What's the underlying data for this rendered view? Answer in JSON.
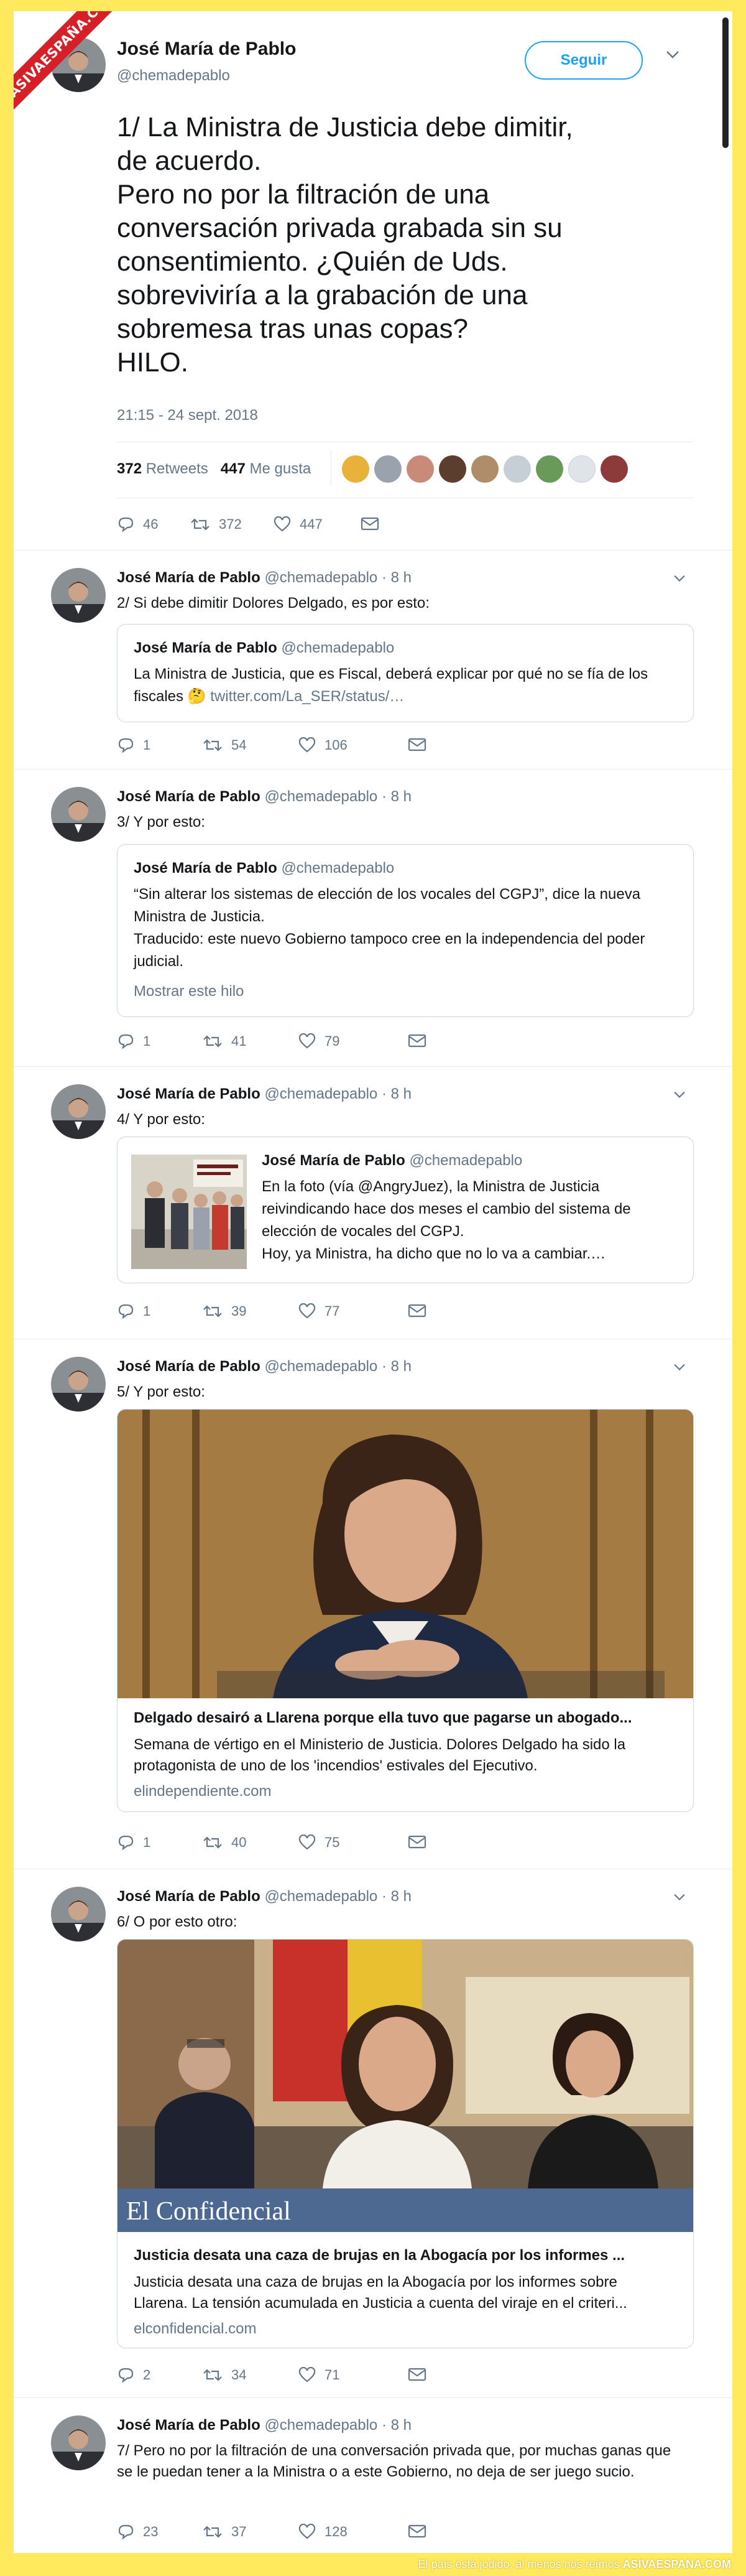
{
  "watermark": "ASIVAESPAÑA.COM",
  "main_tweet": {
    "name": "José María de Pablo",
    "handle": "@chemadepablo",
    "follow_label": "Seguir",
    "text": "1/ La Ministra de Justicia debe dimitir,\nde acuerdo.\nPero no por la filtración de una\nconversación privada grabada sin su\nconsentimiento. ¿Quién de Uds.\nsobreviviría a la grabación de una\nsobremesa tras unas copas?\nHILO.",
    "time": "21:15 - 24 sept. 2018",
    "retweets_count": "372",
    "retweets_label": "Retweets",
    "likes_count": "447",
    "likes_label": "Me gusta",
    "actions": {
      "reply": "46",
      "retweet": "372",
      "like": "447"
    }
  },
  "replies": [
    {
      "name": "José María de Pablo",
      "handle": "@chemadepablo",
      "time": "· 8 h",
      "text": "2/ Si debe dimitir Dolores Delgado, es por esto:",
      "quote": {
        "name": "José María de Pablo",
        "handle": "@chemadepablo",
        "text": "La Ministra de Justicia, que es Fiscal, deberá explicar por qué no se fía de los fiscales 🤔",
        "link": " twitter.com/La_SER/status/…"
      },
      "actions": {
        "reply": "1",
        "retweet": "54",
        "like": "106"
      }
    },
    {
      "name": "José María de Pablo",
      "handle": "@chemadepablo",
      "time": "· 8 h",
      "text": "3/ Y por esto:",
      "quote": {
        "name": "José María de Pablo",
        "handle": "@chemadepablo",
        "text": "“Sin alterar los sistemas de elección de los vocales del CGPJ”, dice la nueva Ministra de Justicia.\nTraducido: este nuevo Gobierno tampoco cree en la independencia del poder judicial.",
        "show_thread": "Mostrar este hilo"
      },
      "actions": {
        "reply": "1",
        "retweet": "41",
        "like": "79"
      }
    },
    {
      "name": "José María de Pablo",
      "handle": "@chemadepablo",
      "time": "· 8 h",
      "text": "4/ Y por esto:",
      "quote": {
        "name": "José María de Pablo",
        "handle": "@chemadepablo",
        "text": "En la foto (vía @AngryJuez), la Ministra de Justicia reivindicando hace dos meses el cambio del sistema de elección de vocales del CGPJ.\nHoy, ya Ministra, ha dicho que no lo va a cambiar.…"
      },
      "actions": {
        "reply": "1",
        "retweet": "39",
        "like": "77"
      }
    },
    {
      "name": "José María de Pablo",
      "handle": "@chemadepablo",
      "time": "· 8 h",
      "text": "5/ Y por esto:",
      "card": {
        "title": "Delgado desairó a Llarena porque ella tuvo que pagarse un abogado...",
        "description": "Semana de vértigo en el Ministerio de Justicia. Dolores Delgado ha sido la protagonista de uno de los 'incendios' estivales del Ejecutivo.",
        "url": "elindependiente.com"
      },
      "actions": {
        "reply": "1",
        "retweet": "40",
        "like": "75"
      }
    },
    {
      "name": "José María de Pablo",
      "handle": "@chemadepablo",
      "time": "· 8 h",
      "text": "6/ O por esto otro:",
      "card": {
        "brand": "El Confidencial",
        "title": "Justicia desata una caza de brujas en la Abogacía por los informes ...",
        "description": "Justicia desata una caza de brujas en la Abogacía por los informes sobre Llarena. La tensión acumulada en Justicia a cuenta del viraje en el criteri...",
        "url": "elconfidencial.com"
      },
      "actions": {
        "reply": "2",
        "retweet": "34",
        "like": "71"
      }
    },
    {
      "name": "José María de Pablo",
      "handle": "@chemadepablo",
      "time": "· 8 h",
      "text": "7/ Pero no por la filtración de una conversación privada que, por muchas ganas que se le puedan tener a la Ministra o a este Gobierno, no deja de ser juego sucio.",
      "actions": {
        "reply": "23",
        "retweet": "37",
        "like": "128"
      }
    }
  ],
  "footer": {
    "text": "El país está jodido, al menos nos reímos",
    "site": "ASIVAESPANA.COM"
  },
  "colors": {
    "accent": "#1DA1F2",
    "muted": "#657786",
    "frame": "#FFE95C",
    "ribbon": "#D62027"
  }
}
